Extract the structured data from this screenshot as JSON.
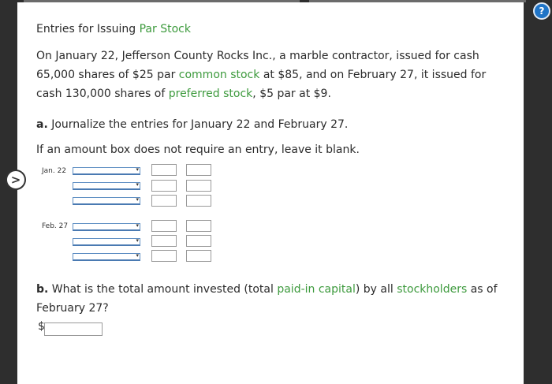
{
  "help_icon": "?",
  "nav_arrow": ">",
  "title": {
    "text": "Entries for Issuing ",
    "term": "Par Stock"
  },
  "problem": {
    "p1": "On January 22, Jefferson County Rocks Inc., a marble contractor, issued for cash 65,000 shares of $25 par ",
    "t1": "common stock",
    "p2": " at $85, and on February 27, it issued for cash 130,000 shares of ",
    "t2": "preferred stock",
    "p3": ", $5 par at $9."
  },
  "part_a": {
    "label": "a.",
    "text": " Journalize the entries for January 22 and February 27."
  },
  "instruction": "If an amount box does not require an entry, leave it blank.",
  "journal": {
    "date1": "Jan. 22",
    "date2": "Feb. 27"
  },
  "part_b": {
    "label": "b.",
    "p1": " What is the total amount invested (total ",
    "t1": "paid-in capital",
    "p2": ") by all ",
    "t2": "stockholders",
    "p3": " as of February 27?",
    "currency": "$"
  }
}
